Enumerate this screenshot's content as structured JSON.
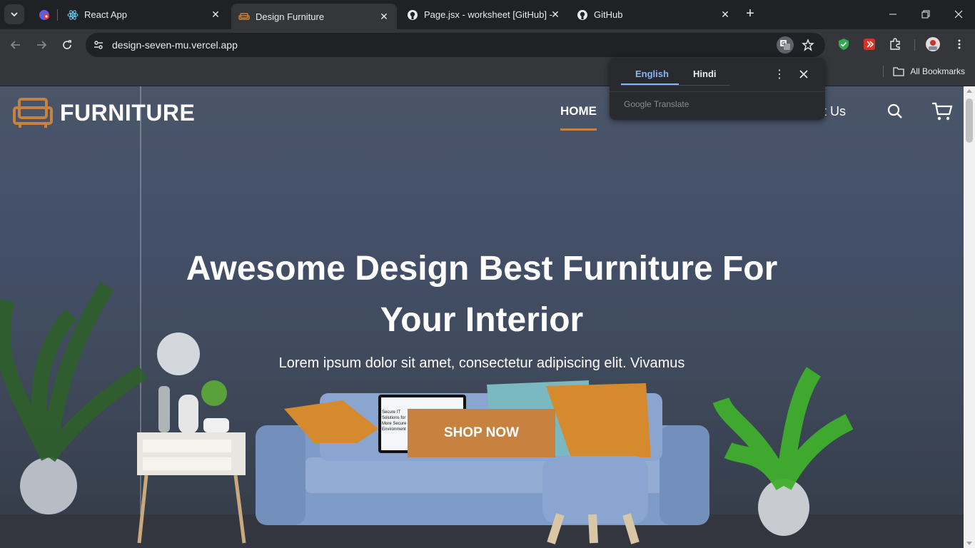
{
  "browser": {
    "tabs": [
      {
        "label": "",
        "icon": "profile-badge-icon"
      },
      {
        "label": "React App",
        "icon": "react-icon"
      },
      {
        "label": "Design Furniture",
        "icon": "sofa-icon",
        "active": true
      },
      {
        "label": "Page.jsx - worksheet [GitHub] -",
        "icon": "github-icon"
      },
      {
        "label": "GitHub",
        "icon": "github-icon"
      }
    ],
    "url": "design-seven-mu.vercel.app",
    "bookmarks_all": "All Bookmarks"
  },
  "translate_popup": {
    "tab_source": "English",
    "tab_target": "Hindi",
    "brand": "Google Translate"
  },
  "site": {
    "logo_text": "FURNITURE",
    "nav_home": "HOME",
    "nav_contact": "act Us",
    "hero_title_line1": "Awesome Design Best Furniture For",
    "hero_title_line2": "Your Interior",
    "hero_subtitle": "Lorem ipsum dolor sit amet, consectetur adipiscing elit. Vivamus",
    "shop_button": "SHOP NOW",
    "accent_color": "#c8823f"
  }
}
